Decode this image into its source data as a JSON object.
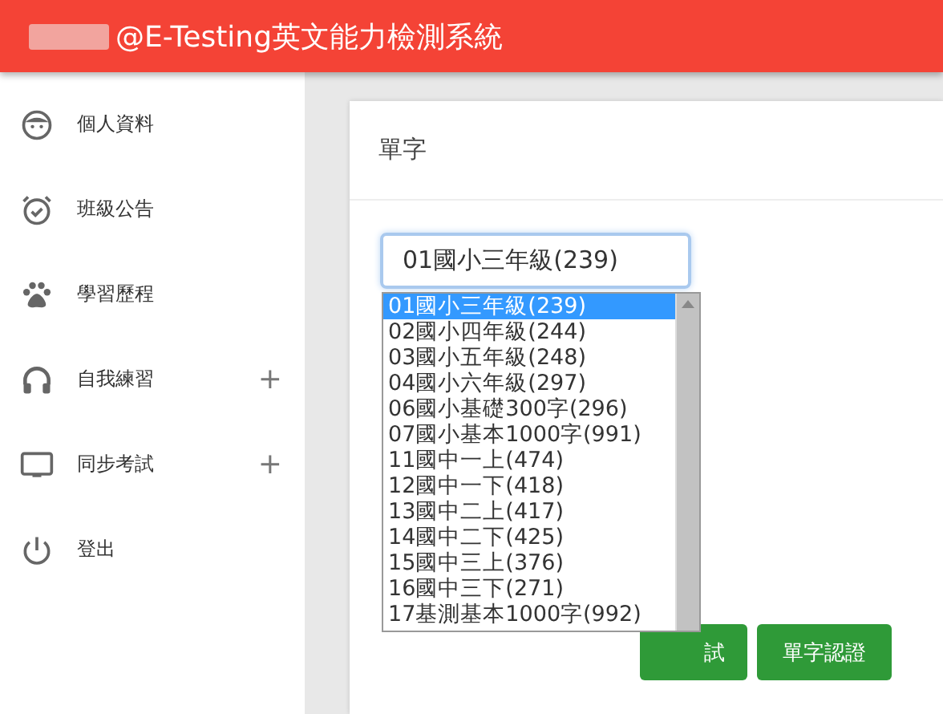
{
  "header": {
    "title": "@E-Testing英文能力檢測系統"
  },
  "sidebar": {
    "items": [
      {
        "kind": "face",
        "label": "個人資料"
      },
      {
        "kind": "alarm",
        "label": "班級公告"
      },
      {
        "kind": "paw",
        "label": "學習歷程"
      },
      {
        "kind": "headphones",
        "label": "自我練習",
        "expander": "+"
      },
      {
        "kind": "monitor",
        "label": "同步考試",
        "expander": "+"
      },
      {
        "kind": "power",
        "label": "登出"
      }
    ]
  },
  "card": {
    "title": "單字",
    "select": {
      "value": "01國小三年級(239)"
    },
    "dropdown": {
      "options": [
        {
          "label": "01國小三年級(239)",
          "selected": true
        },
        {
          "label": "02國小四年級(244)",
          "selected": false
        },
        {
          "label": "03國小五年級(248)",
          "selected": false
        },
        {
          "label": "04國小六年級(297)",
          "selected": false
        },
        {
          "label": "06國小基礎300字(296)",
          "selected": false
        },
        {
          "label": "07國小基本1000字(991)",
          "selected": false
        },
        {
          "label": "11國中一上(474)",
          "selected": false
        },
        {
          "label": "12國中一下(418)",
          "selected": false
        },
        {
          "label": "13國中二上(417)",
          "selected": false
        },
        {
          "label": "14國中二下(425)",
          "selected": false
        },
        {
          "label": "15國中三上(376)",
          "selected": false
        },
        {
          "label": "16國中三下(271)",
          "selected": false
        },
        {
          "label": "17基測基本1000字(992)",
          "selected": false
        }
      ]
    },
    "buttons": [
      {
        "label": "試"
      },
      {
        "label": "單字認證"
      }
    ]
  }
}
